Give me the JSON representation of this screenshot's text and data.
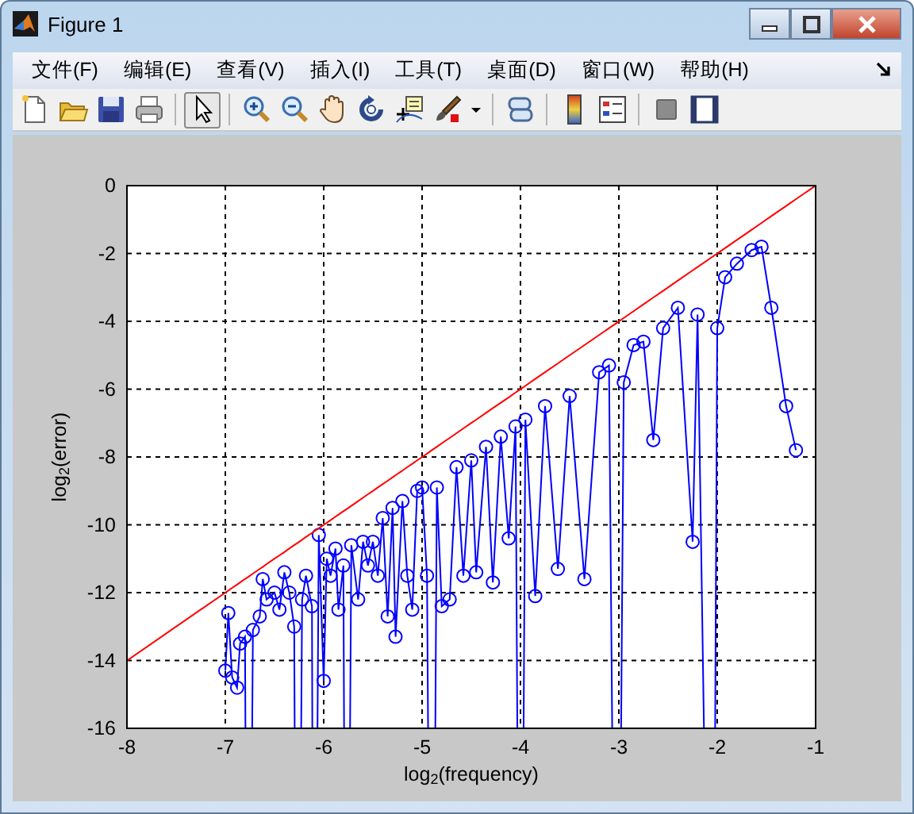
{
  "window": {
    "title": "Figure 1"
  },
  "menu": [
    {
      "label": "文件(F)"
    },
    {
      "label": "编辑(E)"
    },
    {
      "label": "查看(V)"
    },
    {
      "label": "插入(I)"
    },
    {
      "label": "工具(T)"
    },
    {
      "label": "桌面(D)"
    },
    {
      "label": "窗口(W)"
    },
    {
      "label": "帮助(H)"
    }
  ],
  "toolbar": [
    {
      "selected": false
    },
    {
      "selected": false
    },
    {
      "selected": false
    },
    {
      "selected": false
    },
    {
      "selected": true
    },
    {
      "selected": false
    },
    {
      "selected": false
    },
    {
      "selected": false
    },
    {
      "selected": false
    },
    {
      "selected": false
    },
    {
      "selected": false
    },
    {
      "selected": false
    },
    {
      "selected": false
    },
    {
      "selected": false
    },
    {
      "selected": false
    },
    {
      "selected": false
    },
    {
      "selected": false
    }
  ],
  "figure": {
    "chart_data": {
      "type": "line",
      "xlabel": "log$_{2}$(frequency)",
      "ylabel": "log$_{2}$(error)",
      "xlim": [
        -8,
        -1
      ],
      "ylim": [
        -16,
        0
      ],
      "grid": true,
      "xticks": [
        -8,
        -7,
        -6,
        -5,
        -4,
        -3,
        -2,
        -1
      ],
      "yticks": [
        0,
        -2,
        -4,
        -6,
        -8,
        -10,
        -12,
        -14,
        -16
      ],
      "x": [
        -8,
        -7,
        -6.97,
        -6.93,
        -6.88,
        -6.85,
        -6.8,
        -6.77,
        -6.72,
        -6.65,
        -6.62,
        -6.58,
        -6.5,
        -6.45,
        -6.4,
        -6.35,
        -6.3,
        -6.27,
        -6.22,
        -6.18,
        -6.12,
        -6.1,
        -6.05,
        -6,
        -5.97,
        -5.93,
        -5.88,
        -5.85,
        -5.8,
        -5.77,
        -5.72,
        -5.65,
        -5.6,
        -5.55,
        -5.5,
        -5.45,
        -5.4,
        -5.35,
        -5.3,
        -5.27,
        -5.2,
        -5.15,
        -5.1,
        -5.05,
        -5,
        -4.95,
        -4.9,
        -4.85,
        -4.8,
        -4.72,
        -4.65,
        -4.58,
        -4.5,
        -4.45,
        -4.35,
        -4.28,
        -4.2,
        -4.12,
        -4.05,
        -4,
        -3.95,
        -3.85,
        -3.75,
        -3.62,
        -3.5,
        -3.35,
        -3.2,
        -3.1,
        -3.02,
        -2.95,
        -2.85,
        -2.75,
        -2.65,
        -2.55,
        -2.4,
        -2.25,
        -2.2,
        -2.05,
        -2,
        -1.92,
        -1.8,
        -1.65,
        -1.55,
        -1.45,
        -1.3,
        -1.2,
        -1
      ],
      "series": [
        {
          "color": "#0000ff",
          "marker": "o",
          "values": [
            null,
            -14.3,
            -12.6,
            -14.5,
            -14.8,
            -13.5,
            -13.3,
            null,
            -13.1,
            -12.7,
            -11.6,
            -12.2,
            -12,
            -12.5,
            -11.4,
            -12,
            -13,
            null,
            -12.2,
            -11.5,
            -12.4,
            null,
            -10.3,
            -14.6,
            -11,
            -11.5,
            -10.7,
            -12.5,
            -11.2,
            null,
            -10.6,
            -12.2,
            -10.5,
            -11.2,
            -10.5,
            -11.5,
            -9.8,
            -12.7,
            -9.5,
            -13.3,
            -9.3,
            -11.5,
            -12.5,
            -9,
            -8.9,
            -11.5,
            null,
            -8.9,
            -12.4,
            -12.2,
            -8.3,
            -11.5,
            -8.1,
            -11.4,
            -7.7,
            -11.7,
            -7.4,
            -10.4,
            -7.1,
            null,
            -6.9,
            -12.1,
            -6.5,
            -11.3,
            -6.2,
            -11.6,
            -5.5,
            -5.3,
            null,
            -5.8,
            -4.7,
            -4.6,
            -7.5,
            -4.2,
            -3.6,
            -10.5,
            -3.8,
            null,
            -4.2,
            -2.7,
            -2.3,
            -1.9,
            -1.8,
            -3.6,
            -6.5,
            -7.8,
            null
          ]
        },
        {
          "color": "#ff0000",
          "values": [
            -14,
            -12,
            -11.94,
            -11.86,
            -11.76,
            -11.7,
            -11.6,
            -11.54,
            -11.44,
            -11.3,
            -11.24,
            -11.16,
            -11,
            -10.9,
            -10.8,
            -10.7,
            -10.6,
            -10.54,
            -10.44,
            -10.36,
            -10.24,
            -10.2,
            -10.1,
            -10,
            -9.94,
            -9.86,
            -9.76,
            -9.7,
            -9.6,
            -9.54,
            -9.44,
            -9.3,
            -9.2,
            -9.1,
            -9,
            -8.9,
            -8.8,
            -8.7,
            -8.6,
            -8.54,
            -8.4,
            -8.3,
            -8.2,
            -8.1,
            -8,
            -7.9,
            -7.8,
            -7.7,
            -7.6,
            -7.44,
            -7.3,
            -7.16,
            -7,
            -6.9,
            -6.7,
            -6.56,
            -6.4,
            -6.24,
            -6.1,
            -6,
            -5.9,
            -5.7,
            -5.5,
            -5.24,
            -5,
            -4.7,
            -4.4,
            -4.2,
            -4.04,
            -3.9,
            -3.7,
            -3.5,
            -3.3,
            -3.1,
            -2.8,
            -2.5,
            -2.4,
            -2.1,
            -2,
            -1.84,
            -1.6,
            -1.3,
            -1.1,
            -0.9,
            -0.6,
            -0.4,
            0
          ]
        }
      ]
    }
  }
}
